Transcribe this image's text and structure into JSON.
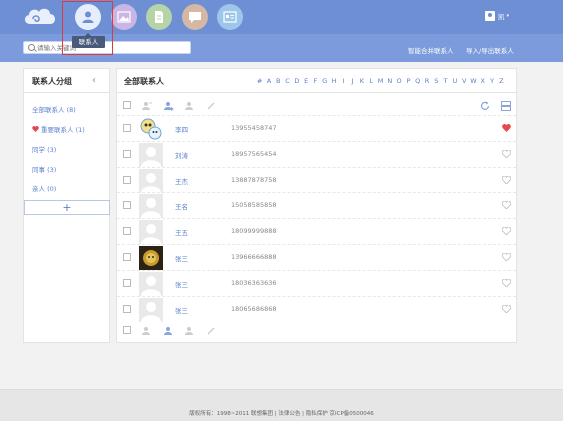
{
  "nav": {
    "items": [
      {
        "label": "联系人",
        "icon": "person-icon",
        "color": "#e7eefb",
        "active": true
      },
      {
        "label": "相册",
        "icon": "photo-icon",
        "color": "#c9b6e4"
      },
      {
        "label": "文件",
        "icon": "document-icon",
        "color": "#b7d3a8"
      },
      {
        "label": "短信",
        "icon": "message-icon",
        "color": "#d4b7a5"
      },
      {
        "label": "通讯录",
        "icon": "card-icon",
        "color": "#9cc7ea"
      }
    ],
    "tooltip": "联系人",
    "user_name": "凯",
    "accent": "#6f8fd4"
  },
  "subbar": {
    "search_placeholder": "请输入关键词",
    "merge_link": "智能合并联系人",
    "import_link": "导入/导出联系人"
  },
  "left": {
    "title": "联系人分组",
    "groups": [
      {
        "label": "全部联系人 (8)"
      },
      {
        "label": "重要联系人 (1)",
        "heart": true
      },
      {
        "label": "同学 (3)"
      },
      {
        "label": "同事 (3)"
      },
      {
        "label": "亲人 (0)"
      }
    ],
    "add_label": "+"
  },
  "main": {
    "title": "全部联系人",
    "letters": [
      "#",
      "A",
      "B",
      "C",
      "D",
      "E",
      "F",
      "G",
      "H",
      "I",
      "J",
      "K",
      "L",
      "M",
      "N",
      "O",
      "P",
      "Q",
      "R",
      "S",
      "T",
      "U",
      "V",
      "W",
      "X",
      "Y",
      "Z"
    ],
    "contacts": [
      {
        "name": "李四",
        "phone": "13955458747",
        "avatar": "cartoon",
        "important": true
      },
      {
        "name": "刘涛",
        "phone": "18957565454",
        "avatar": "default",
        "important": false
      },
      {
        "name": "王杰",
        "phone": "13887878758",
        "avatar": "default",
        "important": false
      },
      {
        "name": "王名",
        "phone": "15058585858",
        "avatar": "default",
        "important": false
      },
      {
        "name": "王五",
        "phone": "18099999888",
        "avatar": "default",
        "important": false
      },
      {
        "name": "张三",
        "phone": "13966666888",
        "avatar": "dark",
        "important": false
      },
      {
        "name": "张三",
        "phone": "18036363636",
        "avatar": "default",
        "important": false
      },
      {
        "name": "张三",
        "phone": "18065686868",
        "avatar": "default",
        "important": false
      }
    ]
  },
  "footer": {
    "text": "版权所有：1998~2011 联想集团 | 法律公告 | 隐私保护 京ICP备0500046"
  }
}
